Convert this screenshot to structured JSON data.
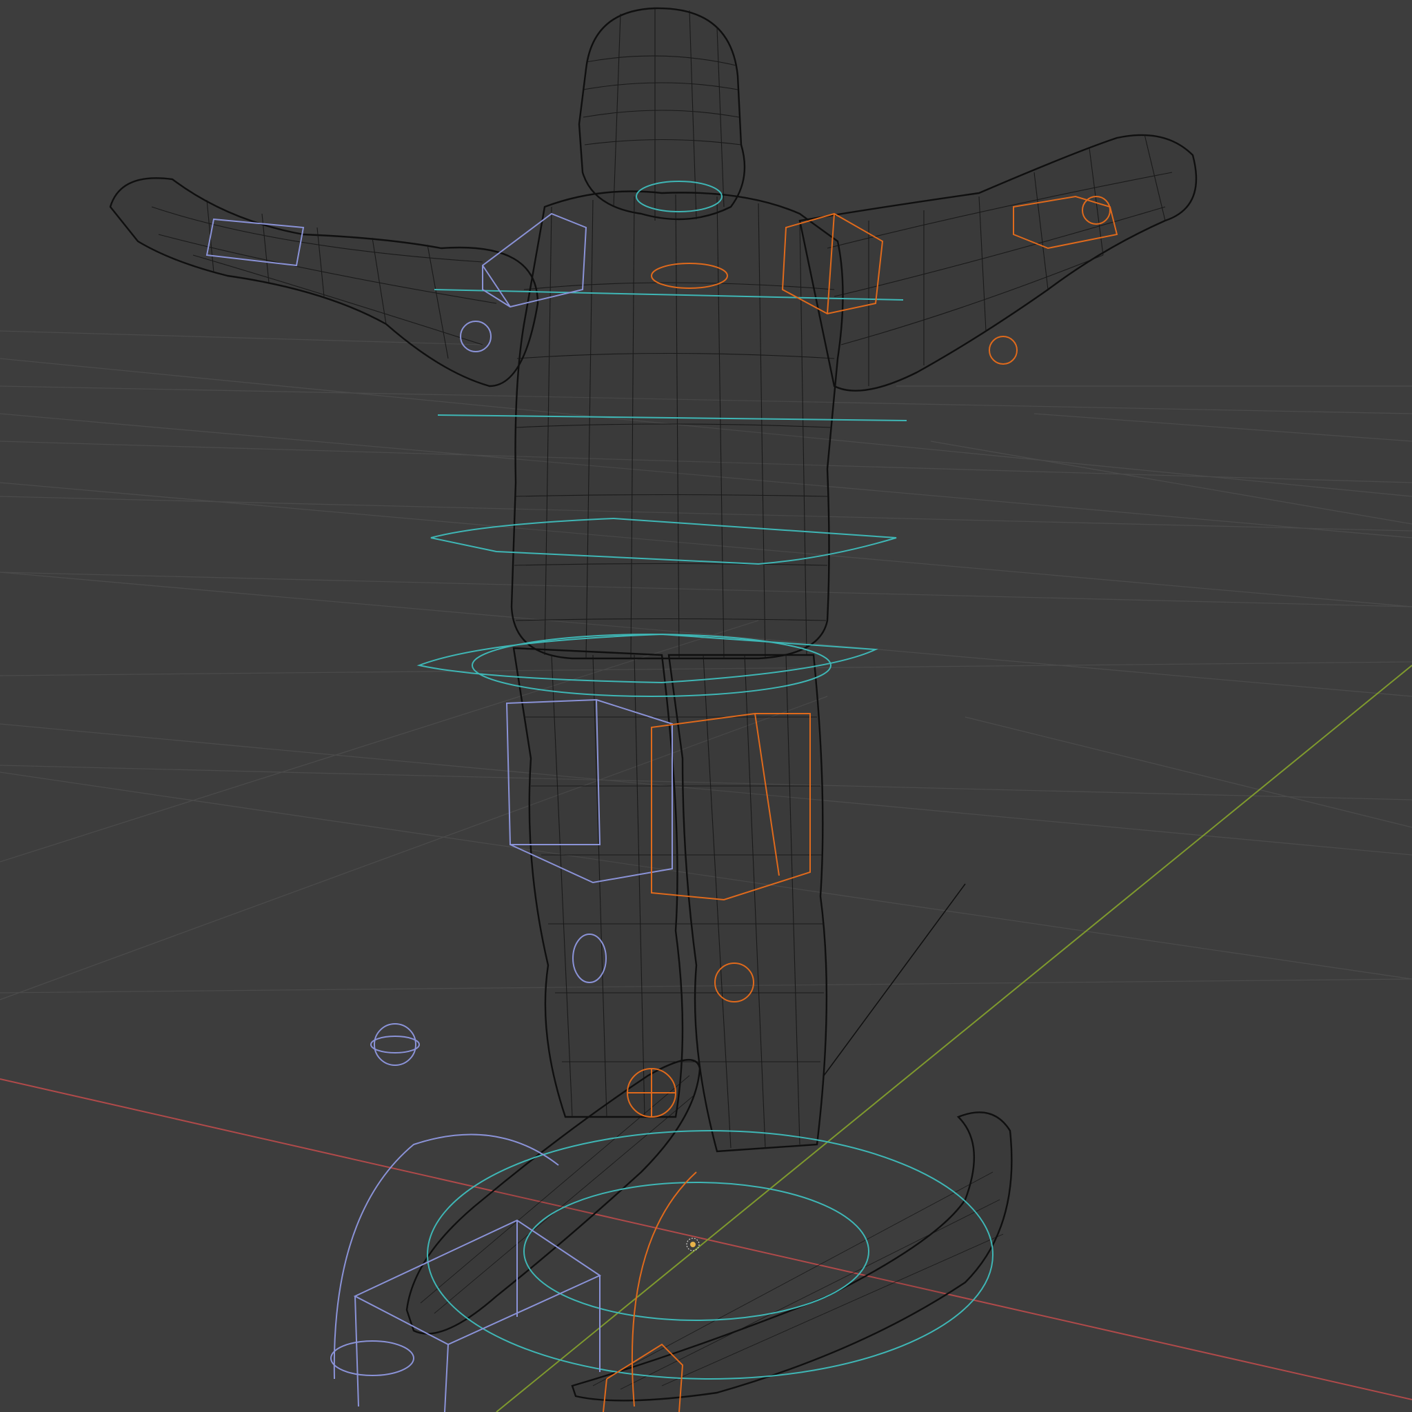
{
  "viewport": {
    "mode": "wireframe",
    "subject": "snowboard rig"
  },
  "colors": {
    "background": "#3d3d3d",
    "grid": "#4b4b4b",
    "axis_x": "#b04a4a",
    "axis_y": "#7f9a2e",
    "mesh_wire": "#141414",
    "control_left": "#8b93d8",
    "control_right": "#e06a1c",
    "control_center": "#3fb7b6"
  },
  "icons": {
    "origin": "origin-dot-icon"
  }
}
